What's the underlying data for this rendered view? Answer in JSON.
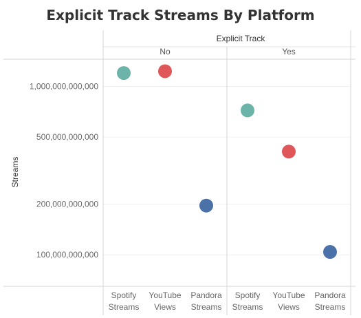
{
  "chart_data": {
    "type": "scatter",
    "title": "Explicit Track Streams By Platform",
    "ylabel": "Streams",
    "column_header": "Explicit Track",
    "panels": [
      "No",
      "Yes"
    ],
    "categories": [
      "Spotify Streams",
      "YouTube Views",
      "Pandora Streams"
    ],
    "category_label_lines": [
      [
        "Spotify",
        "Streams"
      ],
      [
        "YouTube",
        "Views"
      ],
      [
        "Pandora",
        "Streams"
      ]
    ],
    "y_scale": "log",
    "ylim": [
      65000000000,
      1450000000000
    ],
    "y_ticks": [
      100000000000,
      200000000000,
      500000000000,
      1000000000000
    ],
    "y_tick_labels": [
      "100,000,000,000",
      "200,000,000,000",
      "500,000,000,000",
      "1,000,000,000,000"
    ],
    "grid": true,
    "colors": {
      "Spotify Streams": "#6cb3aa",
      "YouTube Views": "#e05759",
      "Pandora Streams": "#4a72a8"
    },
    "points": [
      {
        "panel": "No",
        "category": "Spotify Streams",
        "y": 1200000000000
      },
      {
        "panel": "No",
        "category": "YouTube Views",
        "y": 1230000000000
      },
      {
        "panel": "No",
        "category": "Pandora Streams",
        "y": 196000000000
      },
      {
        "panel": "Yes",
        "category": "Spotify Streams",
        "y": 720000000000
      },
      {
        "panel": "Yes",
        "category": "YouTube Views",
        "y": 410000000000
      },
      {
        "panel": "Yes",
        "category": "Pandora Streams",
        "y": 104000000000
      }
    ]
  }
}
